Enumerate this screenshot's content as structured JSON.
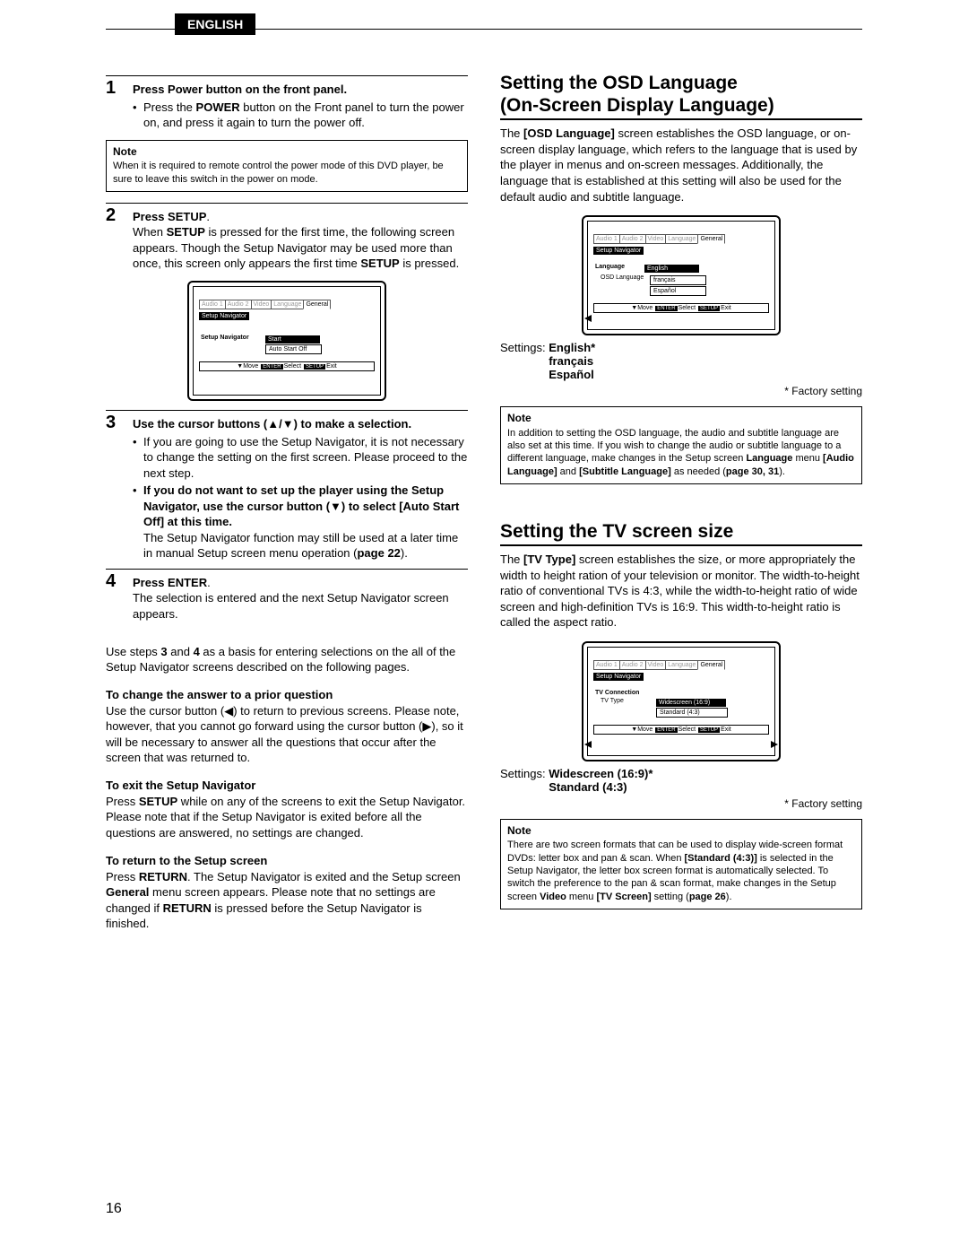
{
  "languageTab": "ENGLISH",
  "pageNumber": "16",
  "steps": [
    {
      "num": "1",
      "title": "Press  Power button on the front panel.",
      "bullets": [
        {
          "plain": "Press the ",
          "bold": "POWER",
          "after": " button on the Front panel to turn the power on, and press it again to turn the power off."
        }
      ],
      "note": {
        "title": "Note",
        "body": "When it is required to remote control the power mode of this DVD player, be sure to leave this switch in the power on mode."
      }
    },
    {
      "num": "2",
      "title": "Press SETUP",
      "title_after": ".",
      "body": "When ",
      "body_bold": "SETUP",
      "body_after": " is pressed for the first time, the following screen appears. Though the Setup Navigator may be used more than once, this screen only appears the first time ",
      "body_bold2": "SETUP",
      "body_after2": " is pressed."
    },
    {
      "num": "3",
      "title": "Use the cursor buttons (▲/▼) to make a selection.",
      "bullets": [
        {
          "plain": "If you are going to use the Setup Navigator, it is not necessary to change the setting on the first screen. Please proceed to the next step."
        },
        {
          "bold_full": "If you do not want to set up the player using the Setup Navigator, use the cursor button (▼) to select [Auto Start Off] at this time.",
          "cont": "The Setup Navigator function may still be used at a later time in manual Setup screen menu operation (",
          "cont_bold": "page 22",
          "cont_after": ")."
        }
      ]
    },
    {
      "num": "4",
      "title": "Press ENTER",
      "title_after": ".",
      "plain": "The selection is entered and the next Setup Navigator screen appears."
    }
  ],
  "leftMid": {
    "p1a": "Use steps ",
    "p1b": "3",
    "p1c": " and ",
    "p1d": "4",
    "p1e": " as a basis for entering selections on the all of the Setup Navigator screens described on the following pages."
  },
  "leftSubs": [
    {
      "h": "To change the answer to a prior question",
      "t": "Use the cursor button (◀) to return to previous screens. Please note, however, that you cannot go forward using the cursor button (▶), so it will be necessary to answer all the questions that occur after the screen that was returned to."
    },
    {
      "h": "To exit the Setup Navigator",
      "runs": [
        {
          "t": "Press "
        },
        {
          "b": "SETUP"
        },
        {
          "t": " while on any of the screens to exit the Setup Navigator. Please note that if the Setup Navigator is exited before all the questions are answered, no settings are changed."
        }
      ]
    },
    {
      "h": "To return to the Setup screen",
      "runs": [
        {
          "t": "Press "
        },
        {
          "b": "RETURN"
        },
        {
          "t": ". The Setup Navigator is exited and the Setup screen "
        },
        {
          "b": "General"
        },
        {
          "t": " menu screen appears. Please note that no settings are changed if "
        },
        {
          "b": "RETURN"
        },
        {
          "t": " is pressed before the Setup Navigator is finished."
        }
      ]
    }
  ],
  "right": {
    "osd": {
      "h1": "Setting the OSD Language",
      "h2": "(On-Screen Display Language)",
      "intro_runs": [
        {
          "t": "The "
        },
        {
          "b": "[OSD Language]"
        },
        {
          "t": " screen establishes the OSD language, or on-screen display language, which refers to the language that is used by the player in menus and on-screen messages. Additionally, the language that is established at this setting will also be used for the default audio and subtitle language."
        }
      ],
      "settings_label": "Settings: ",
      "settings": [
        "English*",
        "français",
        "Español"
      ],
      "factory": "* Factory setting",
      "note": {
        "title": "Note",
        "runs": [
          {
            "t": "In addition to setting the OSD language, the audio and subtitle language are also set at this time. If you wish to change the audio or subtitle language to a different language, make changes in the Setup screen "
          },
          {
            "b": "Language"
          },
          {
            "t": " menu "
          },
          {
            "b": "[Audio Language]"
          },
          {
            "t": " and "
          },
          {
            "b": "[Subtitle Language]"
          },
          {
            "t": " as needed ("
          },
          {
            "b": "page 30, 31"
          },
          {
            "t": ")."
          }
        ]
      }
    },
    "tv": {
      "h": "Setting the TV screen size",
      "intro_runs": [
        {
          "t": "The "
        },
        {
          "b": "[TV Type]"
        },
        {
          "t": " screen establishes the size, or more appropriately the width to height ration of your television or monitor. The width-to-height ratio of conventional TVs is 4:3, while the width-to-height ratio of wide screen and high-definition TVs is 16:9. This width-to-height ratio is called the aspect ratio."
        }
      ],
      "settings_label": "Settings: ",
      "settings": [
        "Widescreen (16:9)*",
        "Standard (4:3)"
      ],
      "factory": "* Factory setting",
      "note": {
        "title": "Note",
        "runs": [
          {
            "t": "There are two screen formats that can be used to display wide-screen format DVDs: letter box and pan & scan. When "
          },
          {
            "b": "[Standard (4:3)]"
          },
          {
            "t": " is selected in the Setup Navigator, the letter box screen format is automatically selected. To switch the preference to the pan & scan format, make changes in the Setup screen "
          },
          {
            "b": "Video"
          },
          {
            "t": " menu "
          },
          {
            "b": "[TV Screen]"
          },
          {
            "t": " setting ("
          },
          {
            "b": "page 26"
          },
          {
            "t": ")."
          }
        ]
      }
    }
  },
  "ui": {
    "tabs": [
      "Audio 1",
      "Audio 2",
      "Video",
      "Language",
      "General"
    ],
    "sn": "Setup Navigator",
    "screen1_row": "Setup Navigator",
    "screen1_start": "Start",
    "screen1_auto": "Auto Start Off",
    "footer": {
      "move": "Move",
      "select": "Select",
      "exit": "Exit",
      "enter": "ENTER",
      "setup": "SETUP"
    },
    "screen2_row1": "Language",
    "screen2_row2": "OSD Language",
    "screen2_opts": [
      "English",
      "français",
      "Español"
    ],
    "screen3_row1": "TV Connection",
    "screen3_row2": "TV Type",
    "screen3_opts": [
      "Widescreen (16:9)",
      "Standard (4:3)"
    ]
  }
}
